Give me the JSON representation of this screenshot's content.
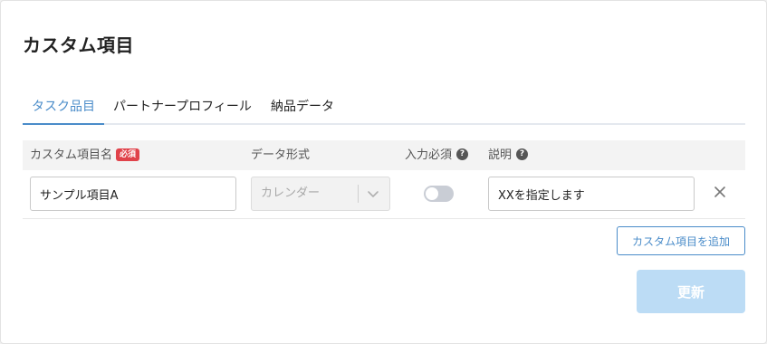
{
  "page": {
    "title": "カスタム項目"
  },
  "tabs": [
    {
      "label": "タスク品目",
      "active": true
    },
    {
      "label": "パートナープロフィール",
      "active": false
    },
    {
      "label": "納品データ",
      "active": false
    }
  ],
  "table": {
    "headers": {
      "name": "カスタム項目名",
      "required_badge": "必須",
      "type": "データ形式",
      "required": "入力必須",
      "description": "説明",
      "help_icon": "?"
    },
    "rows": [
      {
        "name": "サンプル項目A",
        "type": "カレンダー",
        "required": false,
        "description": "XXを指定します"
      }
    ]
  },
  "buttons": {
    "add": "カスタム項目を追加",
    "update": "更新"
  },
  "colors": {
    "accent": "#4a8cc9",
    "badge": "#e0424a",
    "update_disabled": "#bcdcf5"
  },
  "icons": {
    "help": "question-circle-icon",
    "close": "close-icon",
    "chevron": "chevron-down-icon"
  }
}
